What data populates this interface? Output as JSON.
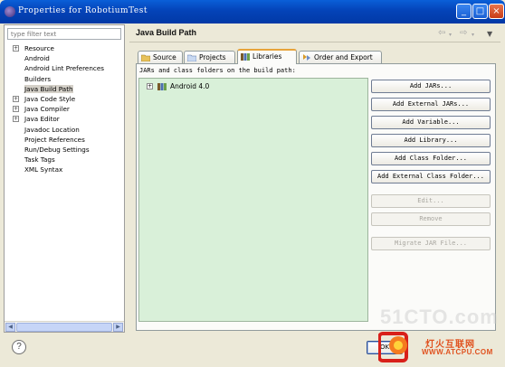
{
  "window": {
    "title": "Properties for RobotiumTest",
    "icon": "eclipse-icon"
  },
  "sidebar": {
    "filter_placeholder": "type filter text",
    "items": [
      {
        "label": "Resource",
        "expandable": true
      },
      {
        "label": "Android",
        "expandable": false
      },
      {
        "label": "Android Lint Preferences",
        "expandable": false
      },
      {
        "label": "Builders",
        "expandable": false
      },
      {
        "label": "Java Build Path",
        "expandable": false,
        "selected": true
      },
      {
        "label": "Java Code Style",
        "expandable": true
      },
      {
        "label": "Java Compiler",
        "expandable": true
      },
      {
        "label": "Java Editor",
        "expandable": true
      },
      {
        "label": "Javadoc Location",
        "expandable": false
      },
      {
        "label": "Project References",
        "expandable": false
      },
      {
        "label": "Run/Debug Settings",
        "expandable": false
      },
      {
        "label": "Task Tags",
        "expandable": false
      },
      {
        "label": "XML Syntax",
        "expandable": false
      }
    ]
  },
  "page": {
    "title": "Java Build Path"
  },
  "tabs": [
    {
      "label": "Source",
      "icon": "source-folder-icon"
    },
    {
      "label": "Projects",
      "icon": "projects-icon"
    },
    {
      "label": "Libraries",
      "icon": "libraries-icon",
      "active": true
    },
    {
      "label": "Order and Export",
      "icon": "order-export-icon"
    }
  ],
  "libraries": {
    "caption": "JARs and class folders on the build path:",
    "items": [
      {
        "label": "Android 4.0",
        "icon": "library-icon"
      }
    ]
  },
  "buttons": [
    {
      "label": "Add JARs...",
      "enabled": true
    },
    {
      "label": "Add External JARs...",
      "enabled": true
    },
    {
      "label": "Add Variable...",
      "enabled": true
    },
    {
      "label": "Add Library...",
      "enabled": true
    },
    {
      "label": "Add Class Folder...",
      "enabled": true
    },
    {
      "label": "Add External Class Folder...",
      "enabled": true
    },
    {
      "label": "Edit...",
      "enabled": false
    },
    {
      "label": "Remove",
      "enabled": false
    },
    {
      "label": "Migrate JAR File...",
      "enabled": false
    }
  ],
  "footer": {
    "help_symbol": "?",
    "ok_label": "OK"
  },
  "watermarks": {
    "site": "51CTO.com",
    "brand_cn": "灯火互联网",
    "brand_url": "WWW.ATCPU.COM"
  }
}
